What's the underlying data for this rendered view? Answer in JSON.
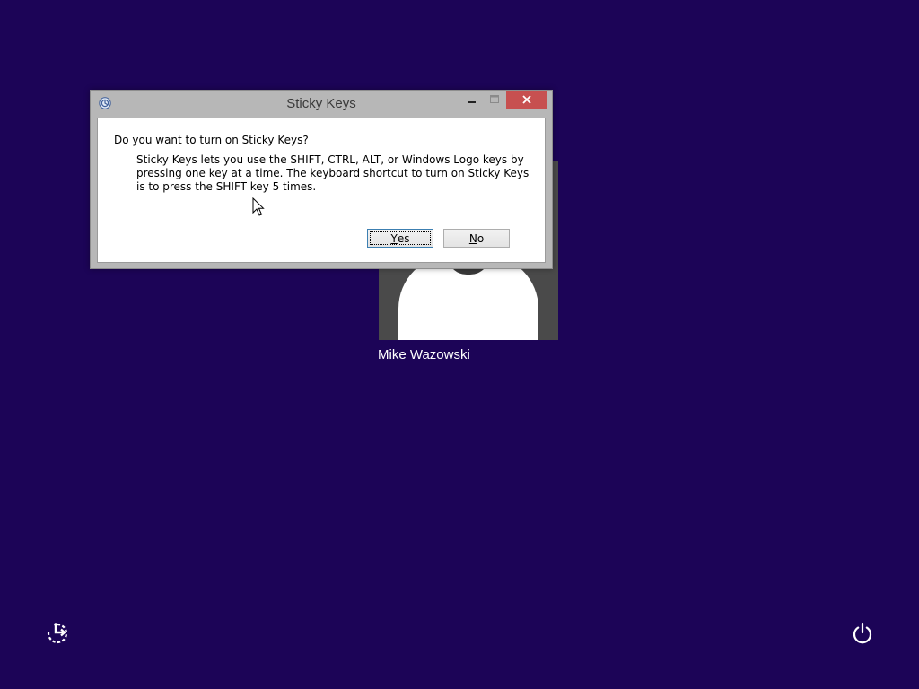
{
  "user": {
    "name": "Mike Wazowski"
  },
  "dialog": {
    "title": "Sticky Keys",
    "question": "Do you want to turn on Sticky Keys?",
    "description": "Sticky Keys lets you use the SHIFT, CTRL, ALT, or Windows Logo keys by pressing one key at a time. The keyboard shortcut to turn on Sticky Keys is to press the SHIFT key 5 times.",
    "yes_label_prefix": "Y",
    "yes_label_rest": "es",
    "no_label_prefix": "N",
    "no_label_rest": "o",
    "default_button": "Yes"
  },
  "icons": {
    "title": "ease-of-access-icon",
    "minimize": "minimize-icon",
    "maximize": "maximize-icon",
    "close": "close-icon",
    "ease_of_access": "ease-of-access-icon",
    "power": "power-icon",
    "cursor": "mouse-pointer-icon"
  },
  "colors": {
    "background": "#1c0457",
    "close_button": "#c75050",
    "dialog_frame": "#b7b7b7",
    "default_button_border": "#3c7fb1"
  }
}
